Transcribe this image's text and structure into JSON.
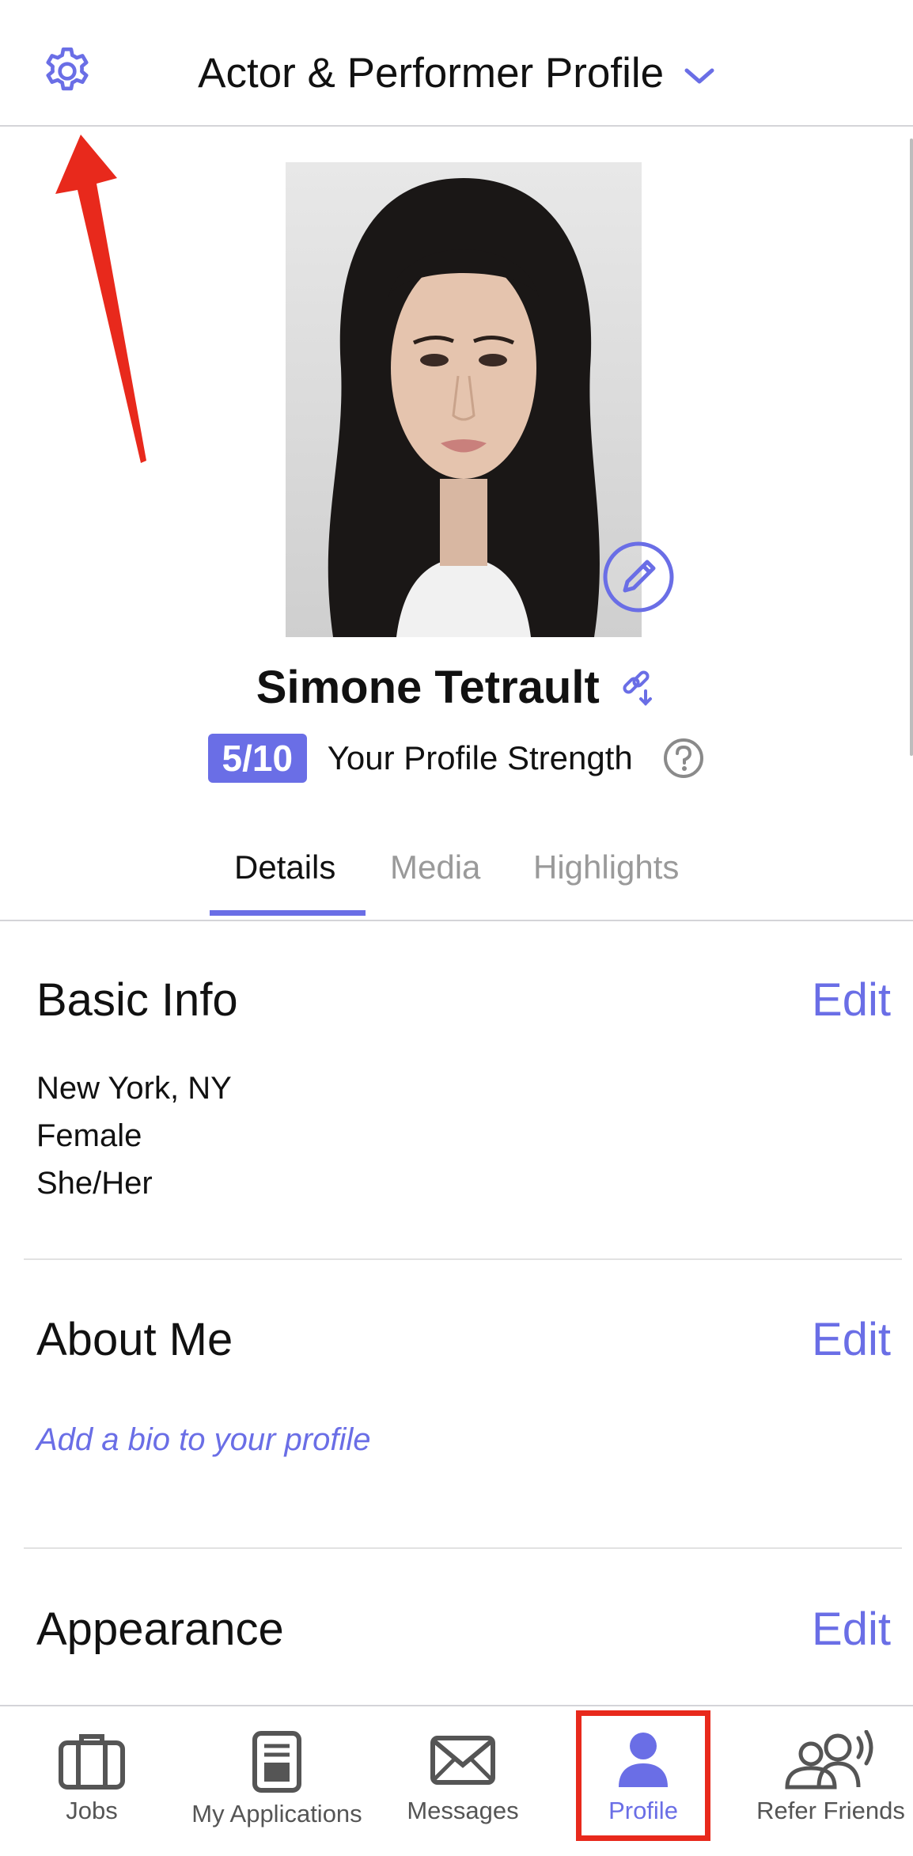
{
  "header": {
    "title": "Actor & Performer Profile"
  },
  "profile": {
    "name": "Simone Tetrault",
    "strength_score": "5/10",
    "strength_label": "Your Profile Strength"
  },
  "tabs": [
    {
      "label": "Details"
    },
    {
      "label": "Media"
    },
    {
      "label": "Highlights"
    }
  ],
  "sections": {
    "basic_info": {
      "title": "Basic Info",
      "edit": "Edit",
      "lines": [
        "New York, NY",
        "Female",
        "She/Her"
      ]
    },
    "about_me": {
      "title": "About Me",
      "edit": "Edit",
      "bio_prompt": "Add a bio to your profile"
    },
    "appearance": {
      "title": "Appearance",
      "edit": "Edit"
    }
  },
  "bottom_nav": [
    {
      "label": "Jobs",
      "icon": "briefcase-icon"
    },
    {
      "label": "My Applications",
      "icon": "applications-icon"
    },
    {
      "label": "Messages",
      "icon": "envelope-icon"
    },
    {
      "label": "Profile",
      "icon": "person-icon"
    },
    {
      "label": "Refer Friends",
      "icon": "refer-friends-icon"
    }
  ],
  "colors": {
    "accent": "#6a6ee6",
    "annotation": "#e8291c"
  }
}
